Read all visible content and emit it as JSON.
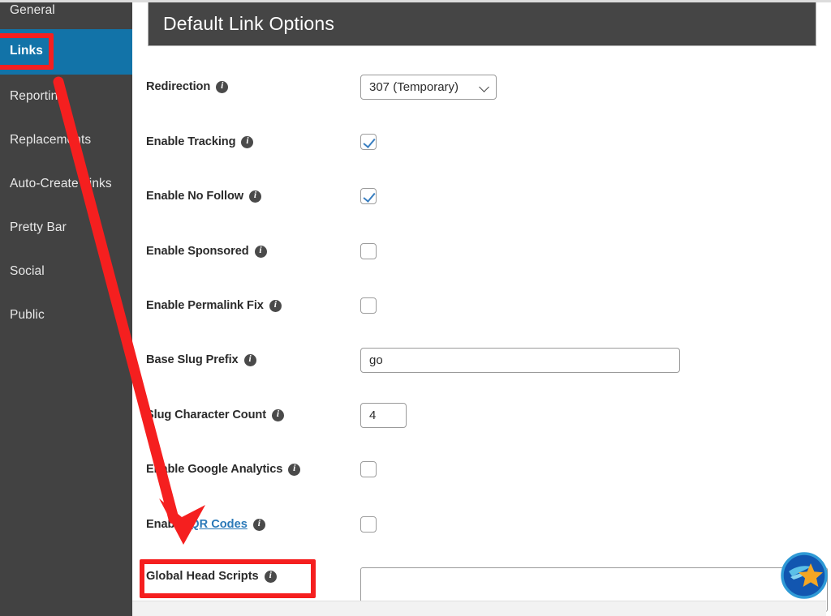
{
  "sidebar": {
    "items": [
      {
        "label": "General",
        "active": false
      },
      {
        "label": "Links",
        "active": true
      },
      {
        "label": "Reporting",
        "active": false
      },
      {
        "label": "Replacements",
        "active": false
      },
      {
        "label": "Auto-Create Links",
        "active": false
      },
      {
        "label": "Pretty Bar",
        "active": false
      },
      {
        "label": "Social",
        "active": false
      },
      {
        "label": "Public",
        "active": false
      }
    ]
  },
  "panel": {
    "title": "Default Link Options"
  },
  "fields": {
    "redirection": {
      "label": "Redirection",
      "info_icon": "info-icon",
      "value": "307 (Temporary)",
      "options": [
        "307 (Temporary)"
      ]
    },
    "enable_tracking": {
      "label": "Enable Tracking",
      "info_icon": "info-icon",
      "checked": "checked"
    },
    "enable_no_follow": {
      "label": "Enable No Follow",
      "info_icon": "info-icon",
      "checked": "checked"
    },
    "enable_sponsored": {
      "label": "Enable Sponsored",
      "info_icon": "info-icon",
      "checked": "unchecked"
    },
    "enable_permalink_fix": {
      "label": "Enable Permalink Fix",
      "info_icon": "info-icon",
      "checked": "unchecked"
    },
    "base_slug_prefix": {
      "label": "Base Slug Prefix",
      "info_icon": "info-icon",
      "value": "go"
    },
    "slug_character_count": {
      "label": "Slug Character Count",
      "info_icon": "info-icon",
      "value": "4"
    },
    "enable_google_analytics": {
      "label": "Enable Google Analytics",
      "info_icon": "info-icon",
      "checked": "unchecked"
    },
    "enable_qr_codes": {
      "label_prefix": "Enable",
      "link_label": "QR Codes",
      "info_icon": "info-icon",
      "checked": "unchecked"
    },
    "global_head_scripts": {
      "label": "Global Head Scripts",
      "info_icon": "info-icon",
      "value": ""
    }
  },
  "annotations": {
    "highlight_color": "#f51f1f",
    "links_highlight_target": "Links",
    "global_head_scripts_highlight_target": "Global Head Scripts",
    "arrow": {
      "from": "Links",
      "to": "Global Head Scripts",
      "color": "#f51f1f"
    }
  },
  "badge": {
    "name": "pretty-links-logo-badge",
    "circle_color": "#1256b0",
    "ring_color": "#2f9ad6",
    "star_color": "#f5a623",
    "wing_color": "#5bc0e8"
  },
  "icons": {
    "info": "i",
    "chevron_down": "chevron-down-icon",
    "check": "check-icon"
  }
}
